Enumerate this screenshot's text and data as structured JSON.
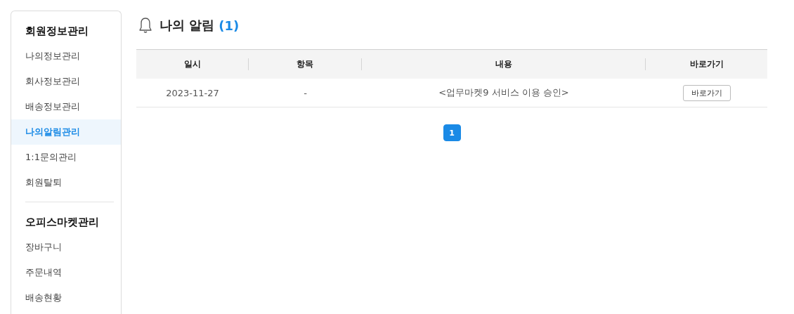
{
  "sidebar": {
    "sections": [
      {
        "title": "회원정보관리",
        "items": [
          {
            "label": "나의정보관리",
            "selected": false
          },
          {
            "label": "회사정보관리",
            "selected": false
          },
          {
            "label": "배송정보관리",
            "selected": false
          },
          {
            "label": "나의알림관리",
            "selected": true
          },
          {
            "label": "1:1문의관리",
            "selected": false
          },
          {
            "label": "회원탈퇴",
            "selected": false
          }
        ]
      },
      {
        "title": "오피스마켓관리",
        "items": [
          {
            "label": "장바구니",
            "selected": false
          },
          {
            "label": "주문내역",
            "selected": false
          },
          {
            "label": "배송현황",
            "selected": false
          }
        ]
      }
    ]
  },
  "page": {
    "title": "나의 알림",
    "count": "(1)"
  },
  "table": {
    "columns": [
      "일시",
      "항목",
      "내용",
      "바로가기"
    ],
    "rows": [
      {
        "date": "2023-11-27",
        "item": "-",
        "content": "<업무마켓9 서비스 이용 승인>",
        "link": "바로가기"
      }
    ]
  },
  "pagination": [
    {
      "label": "1",
      "selected": true
    }
  ]
}
